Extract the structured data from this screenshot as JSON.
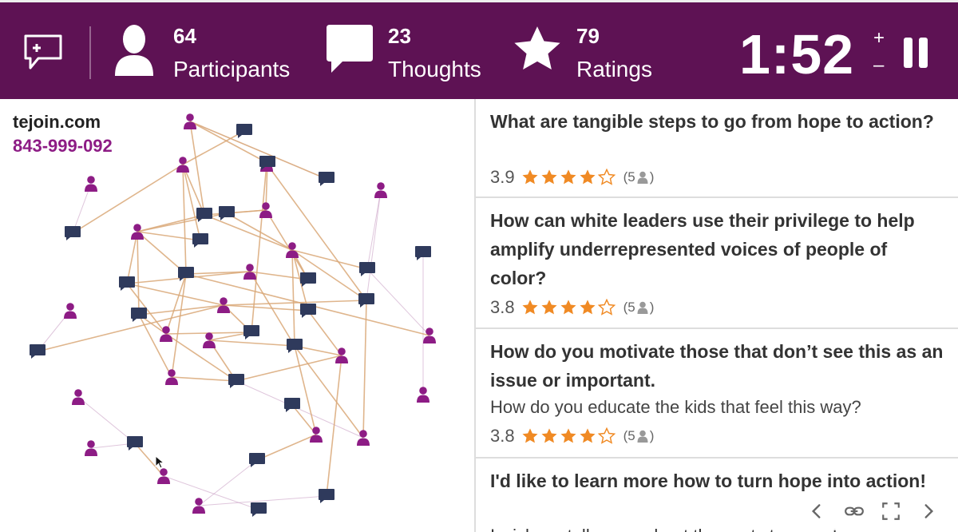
{
  "header": {
    "participants": {
      "count": "64",
      "label": "Participants",
      "icon": "person-icon"
    },
    "thoughts": {
      "count": "23",
      "label": "Thoughts",
      "icon": "speech-bubble-icon"
    },
    "ratings": {
      "count": "79",
      "label": "Ratings",
      "icon": "star-icon"
    },
    "timer": "1:52",
    "timer_plus": "+",
    "timer_minus": "–"
  },
  "join": {
    "url": "tejoin.com",
    "code": "843-999-092"
  },
  "thoughts": [
    {
      "title": "What are tangible steps to go from hope to action?",
      "avg": "3.9",
      "stars": 4,
      "count_prefix": "(5",
      "count_suffix": ")"
    },
    {
      "title": "How can white leaders use their privilege to help amplify underrepresented voices of people of color?",
      "avg": "3.8",
      "stars": 4,
      "count_prefix": "(5",
      "count_suffix": ")"
    },
    {
      "title": "How do you motivate those that don’t see this as an issue or important.",
      "sub": "How do you educate the kids that feel this way?",
      "avg": "3.8",
      "stars": 4,
      "count_prefix": "(5",
      "count_suffix": ")"
    },
    {
      "title": "I'd like to learn more how to turn hope into action!",
      "sub": "I wish we talk more about the next steps and..."
    }
  ],
  "colors": {
    "header_bg": "#5e1254",
    "participant_node": "#8d1c85",
    "thought_node": "#2f3a5c",
    "edge": "#d9a878",
    "star": "#f08a24"
  }
}
